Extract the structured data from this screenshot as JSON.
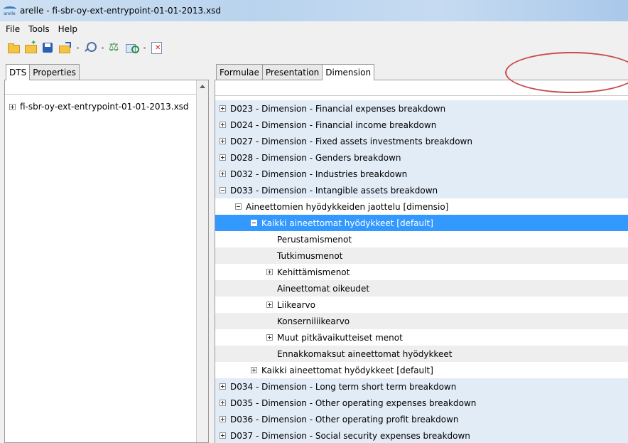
{
  "window": {
    "title": "arelle - fi-sbr-oy-ext-entrypoint-01-01-2013.xsd",
    "app_icon_text": "arelle"
  },
  "menu": [
    "File",
    "Tools",
    "Help"
  ],
  "left_panel": {
    "tabs": [
      "DTS",
      "Properties"
    ],
    "active_tab": "DTS",
    "tree": [
      {
        "label": "fi-sbr-oy-ext-entrypoint-01-01-2013.xsd",
        "expander": "plus"
      }
    ]
  },
  "right_panel": {
    "tabs": [
      "Formulae",
      "Presentation",
      "Dimension"
    ],
    "active_tab": "Dimension",
    "rows": [
      {
        "label": "D023 - Dimension - Financial expenses breakdown",
        "level": 0,
        "expander": "plus",
        "style": "blue"
      },
      {
        "label": "D024 - Dimension - Financial income breakdown",
        "level": 0,
        "expander": "plus",
        "style": "blue"
      },
      {
        "label": "D027 - Dimension - Fixed assets investments breakdown",
        "level": 0,
        "expander": "plus",
        "style": "blue"
      },
      {
        "label": "D028 - Dimension - Genders breakdown",
        "level": 0,
        "expander": "plus",
        "style": "blue"
      },
      {
        "label": "D032 - Dimension - Industries breakdown",
        "level": 0,
        "expander": "plus",
        "style": "blue"
      },
      {
        "label": "D033 - Dimension - Intangible assets breakdown",
        "level": 0,
        "expander": "minus",
        "style": "blue"
      },
      {
        "label": "Aineettomien hyödykkeiden jaottelu [dimensio]",
        "level": 1,
        "expander": "minus",
        "style": "white"
      },
      {
        "label": "Kaikki aineettomat hyödykkeet [default]",
        "level": 2,
        "expander": "minus",
        "style": "selected"
      },
      {
        "label": "Perustamismenot",
        "level": 3,
        "expander": "none",
        "style": "white"
      },
      {
        "label": "Tutkimusmenot",
        "level": 3,
        "expander": "none",
        "style": "gray"
      },
      {
        "label": "Kehittämismenot",
        "level": 3,
        "expander": "plus",
        "style": "white"
      },
      {
        "label": "Aineettomat oikeudet",
        "level": 3,
        "expander": "none",
        "style": "gray"
      },
      {
        "label": "Liikearvo",
        "level": 3,
        "expander": "plus",
        "style": "white"
      },
      {
        "label": "Konserniliikearvo",
        "level": 3,
        "expander": "none",
        "style": "gray"
      },
      {
        "label": "Muut pitkävaikutteiset menot",
        "level": 3,
        "expander": "plus",
        "style": "white"
      },
      {
        "label": "Ennakkomaksut aineettomat hyödykkeet",
        "level": 3,
        "expander": "none",
        "style": "gray"
      },
      {
        "label": "Kaikki aineettomat hyödykkeet [default]",
        "level": 2,
        "expander": "plus",
        "style": "white"
      },
      {
        "label": "D034 - Dimension - Long term short term breakdown",
        "level": 0,
        "expander": "plus",
        "style": "blue"
      },
      {
        "label": "D035 - Dimension - Other operating expenses breakdown",
        "level": 0,
        "expander": "plus",
        "style": "blue"
      },
      {
        "label": "D036 - Dimension - Other operating profit breakdown",
        "level": 0,
        "expander": "plus",
        "style": "blue"
      },
      {
        "label": "D037 - Dimension - Social security expenses breakdown",
        "level": 0,
        "expander": "plus",
        "style": "blue"
      }
    ]
  },
  "colors": {
    "selected_row": "#3399ff",
    "top_level_row": "#e1ecf7",
    "annotation_circle": "#c94a4a"
  }
}
